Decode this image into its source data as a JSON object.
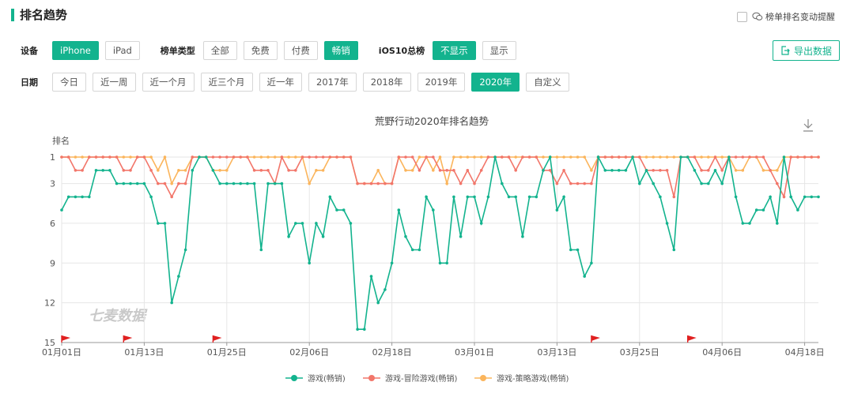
{
  "header": {
    "title": "排名趋势",
    "notify_label": "榜单排名变动提醒"
  },
  "filters": {
    "device": {
      "label": "设备",
      "options": [
        {
          "label": "iPhone",
          "active": true
        },
        {
          "label": "iPad",
          "active": false
        }
      ]
    },
    "list_type": {
      "label": "榜单类型",
      "options": [
        {
          "label": "全部",
          "active": false
        },
        {
          "label": "免费",
          "active": false
        },
        {
          "label": "付费",
          "active": false
        },
        {
          "label": "畅销",
          "active": true
        }
      ]
    },
    "ios10": {
      "label": "iOS10总榜",
      "options": [
        {
          "label": "不显示",
          "active": true
        },
        {
          "label": "显示",
          "active": false
        }
      ]
    },
    "date": {
      "label": "日期",
      "options": [
        {
          "label": "今日",
          "active": false
        },
        {
          "label": "近一周",
          "active": false
        },
        {
          "label": "近一个月",
          "active": false
        },
        {
          "label": "近三个月",
          "active": false
        },
        {
          "label": "近一年",
          "active": false
        },
        {
          "label": "2017年",
          "active": false
        },
        {
          "label": "2018年",
          "active": false
        },
        {
          "label": "2019年",
          "active": false
        },
        {
          "label": "2020年",
          "active": true
        },
        {
          "label": "自定义",
          "active": false
        }
      ]
    }
  },
  "export_label": "导出数据",
  "watermark": "七麦数据",
  "colors": {
    "accent": "#13b38e",
    "series1": "#13b38e",
    "series2": "#f2766a",
    "series3": "#fbb55c",
    "flag": "#e02020"
  },
  "chart_data": {
    "type": "line",
    "title": "荒野行动2020年排名趋势",
    "ylabel": "排名",
    "y_inverted": true,
    "ylim": [
      1,
      15
    ],
    "yticks": [
      1,
      3,
      6,
      9,
      12,
      15
    ],
    "x_start": "01月01日",
    "x_ticks": [
      "01月01日",
      "01月13日",
      "01月25日",
      "02月06日",
      "02月18日",
      "03月01日",
      "03月13日",
      "03月25日",
      "04月06日",
      "04月18日"
    ],
    "flag_markers": [
      "01月01日",
      "01月10日",
      "01月23日",
      "03月18日",
      "04月01日"
    ],
    "legend_position": "bottom",
    "series": [
      {
        "name": "游戏(畅销)",
        "values": [
          5,
          4,
          4,
          4,
          4,
          2,
          2,
          2,
          3,
          3,
          3,
          3,
          3,
          4,
          6,
          6,
          12,
          10,
          8,
          2,
          1,
          1,
          2,
          3,
          3,
          3,
          3,
          3,
          3,
          8,
          3,
          3,
          3,
          7,
          6,
          6,
          9,
          6,
          7,
          4,
          5,
          5,
          6,
          14,
          14,
          10,
          12,
          11,
          9,
          5,
          7,
          8,
          8,
          4,
          5,
          9,
          9,
          4,
          7,
          4,
          4,
          6,
          4,
          1,
          3,
          4,
          4,
          7,
          4,
          4,
          2,
          1,
          5,
          4,
          8,
          8,
          10,
          9,
          1,
          2,
          2,
          2,
          2,
          1,
          3,
          2,
          3,
          4,
          6,
          8,
          1,
          1,
          2,
          3,
          3,
          2,
          3,
          1,
          4,
          6,
          6,
          5,
          5,
          4,
          6,
          1,
          4,
          5,
          4,
          4,
          4
        ]
      },
      {
        "name": "游戏-冒险游戏(畅销)",
        "values": [
          1,
          1,
          2,
          2,
          1,
          1,
          1,
          1,
          1,
          2,
          2,
          1,
          1,
          2,
          3,
          3,
          4,
          3,
          3,
          1,
          1,
          1,
          1,
          1,
          1,
          1,
          1,
          1,
          2,
          2,
          2,
          3,
          1,
          2,
          2,
          1,
          1,
          1,
          1,
          1,
          1,
          1,
          1,
          3,
          3,
          3,
          3,
          3,
          3,
          1,
          1,
          1,
          2,
          1,
          1,
          2,
          2,
          2,
          3,
          2,
          3,
          2,
          1,
          1,
          1,
          1,
          2,
          1,
          1,
          1,
          2,
          2,
          3,
          2,
          3,
          3,
          3,
          3,
          1,
          1,
          1,
          1,
          1,
          1,
          1,
          2,
          2,
          2,
          2,
          4,
          1,
          1,
          1,
          2,
          2,
          1,
          2,
          1,
          1,
          1,
          1,
          1,
          1,
          2,
          3,
          4,
          1,
          1,
          1,
          1,
          1
        ]
      },
      {
        "name": "游戏-策略游戏(畅销)",
        "values": [
          1,
          1,
          1,
          1,
          1,
          1,
          1,
          1,
          1,
          1,
          1,
          1,
          1,
          1,
          2,
          1,
          3,
          2,
          2,
          1,
          1,
          1,
          2,
          2,
          2,
          1,
          1,
          1,
          1,
          1,
          1,
          1,
          1,
          1,
          1,
          1,
          3,
          2,
          2,
          1,
          1,
          1,
          1,
          3,
          3,
          3,
          2,
          3,
          3,
          1,
          2,
          2,
          1,
          1,
          2,
          1,
          3,
          1,
          1,
          1,
          1,
          1,
          1,
          1,
          1,
          1,
          1,
          1,
          1,
          1,
          1,
          1,
          1,
          1,
          1,
          1,
          1,
          2,
          1,
          1,
          1,
          1,
          1,
          1,
          1,
          1,
          1,
          1,
          1,
          1,
          1,
          1,
          1,
          1,
          1,
          1,
          1,
          1,
          2,
          2,
          1,
          1,
          2,
          2,
          2,
          1,
          1,
          1,
          1,
          1,
          1
        ]
      }
    ]
  }
}
